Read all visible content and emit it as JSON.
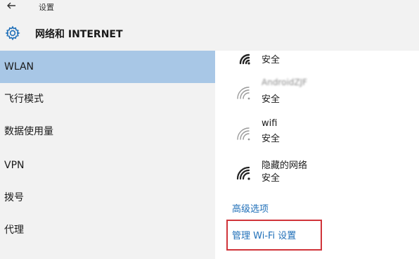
{
  "window": {
    "back_icon": "back-arrow-icon",
    "title": "设置"
  },
  "header": {
    "icon": "gear-icon",
    "title": "网络和 INTERNET"
  },
  "sidebar": {
    "items": [
      {
        "label": "WLAN",
        "active": true
      },
      {
        "label": "飞行模式"
      },
      {
        "label": "数据使用量"
      },
      {
        "label": "VPN"
      },
      {
        "label": "拨号"
      },
      {
        "label": "代理"
      }
    ]
  },
  "networks": [
    {
      "name": "",
      "status": "安全"
    },
    {
      "name": "AndroidZJF",
      "status": "安全"
    },
    {
      "name": "wifi",
      "status": "安全"
    },
    {
      "name": "隐藏的网络",
      "status": "安全"
    }
  ],
  "links": {
    "advanced": "高级选项",
    "manage_wifi": "管理 Wi-Fi 设置"
  },
  "colors": {
    "accent": "#1f6fb8",
    "selected": "#a8c7e6",
    "highlight": "#d0343a",
    "sidebar_bg": "#f2f2f2"
  }
}
